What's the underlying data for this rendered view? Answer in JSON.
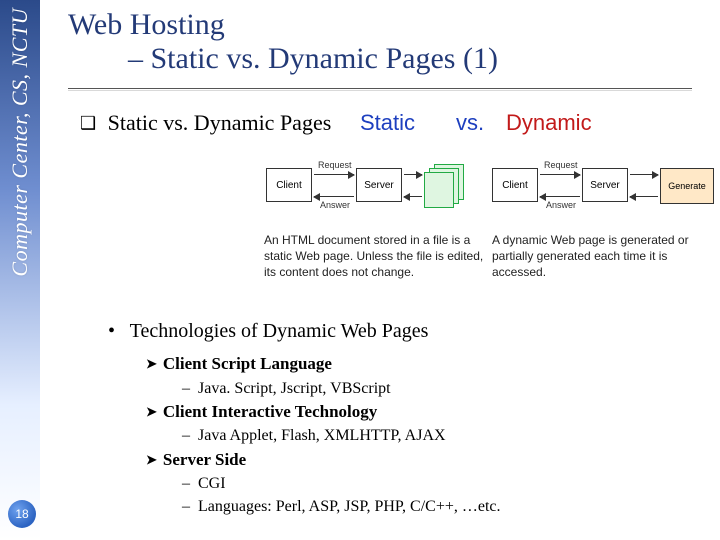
{
  "sidebar": {
    "affiliation": "Computer Center, CS, NCTU",
    "page_number": "18"
  },
  "title": {
    "line1": "Web Hosting",
    "line2": "– Static vs. Dynamic Pages (1)"
  },
  "main_bullet": "Static vs. Dynamic Pages",
  "column_headers": {
    "static": "Static",
    "vs": "vs.",
    "dynamic": "Dynamic"
  },
  "diagram": {
    "client": "Client",
    "server": "Server",
    "request": "Request",
    "answer": "Answer",
    "generate": "Generate"
  },
  "captions": {
    "static": "An HTML document stored in a file is a static Web page. Unless the file is edited, its content does not change.",
    "dynamic": "A dynamic Web page is generated or partially generated each time it is accessed."
  },
  "tech": {
    "heading": "Technologies of Dynamic Web Pages",
    "client_script": {
      "label": "Client Script Language",
      "items": "Java. Script, Jscript, VBScript"
    },
    "client_interactive": {
      "label": "Client Interactive Technology",
      "items": "Java Applet, Flash, XMLHTTP, AJAX"
    },
    "server_side": {
      "label": "Server Side",
      "cgi": "CGI",
      "languages": "Languages: Perl, ASP, JSP, PHP, C/C++, …etc."
    }
  }
}
